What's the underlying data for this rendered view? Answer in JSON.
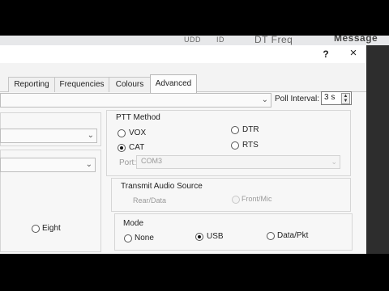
{
  "background_window": {
    "col1": "UDD",
    "col2": "ID",
    "col3": "DT Freq",
    "col4": "Message"
  },
  "dialog": {
    "help_label": "?",
    "close_label": "×",
    "tabs": [
      {
        "label": "Reporting",
        "active": false
      },
      {
        "label": "Frequencies",
        "active": false
      },
      {
        "label": "Colours",
        "active": false
      },
      {
        "label": "Advanced",
        "active": true
      }
    ],
    "poll_interval": {
      "label": "Poll Interval:",
      "value": "3 s"
    },
    "left": {
      "eight_label": "Eight"
    },
    "ptt": {
      "title": "PTT Method",
      "options": [
        {
          "label": "VOX",
          "checked": false
        },
        {
          "label": "DTR",
          "checked": false
        },
        {
          "label": "CAT",
          "checked": true
        },
        {
          "label": "RTS",
          "checked": false
        }
      ],
      "port_label": "Port:",
      "port_value": "COM3"
    },
    "audio_source": {
      "title": "Transmit Audio Source",
      "options": [
        {
          "label": "Rear/Data"
        },
        {
          "label": "Front/Mic"
        }
      ]
    },
    "mode": {
      "title": "Mode",
      "options": [
        {
          "label": "None",
          "checked": false
        },
        {
          "label": "USB",
          "checked": true
        },
        {
          "label": "Data/Pkt",
          "checked": false
        }
      ]
    }
  },
  "icons": {
    "chevron": "chevron-down-icon",
    "spin": "spin-arrows-icon"
  }
}
